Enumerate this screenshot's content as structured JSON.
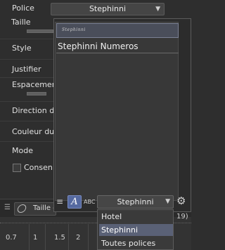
{
  "properties": {
    "font_label": "Police",
    "font_value": "Stephinni",
    "size_label": "Taille",
    "style_label": "Style",
    "justify_label": "Justifier",
    "spacing_label": "Espacemer",
    "direction_label": "Direction d",
    "color_label": "Couleur du",
    "mode_label": "Mode",
    "keep_label": "Consen"
  },
  "preview": {
    "items": [
      "Stephinni",
      "Stephinni Numeros"
    ]
  },
  "font_toolbar": {
    "abc_label": "ABC",
    "italic_glyph": "A",
    "selected_font": "Stephinni",
    "options": [
      "Hotel",
      "Stephinni",
      "Toutes polices"
    ],
    "selected_index": 1,
    "side_text": "19)"
  },
  "timeline": {
    "tab_label": "Taille d",
    "ticks": [
      "0.7",
      "1",
      "1.5",
      "2"
    ]
  },
  "colors": {
    "accent_selection": "#5a6176"
  }
}
